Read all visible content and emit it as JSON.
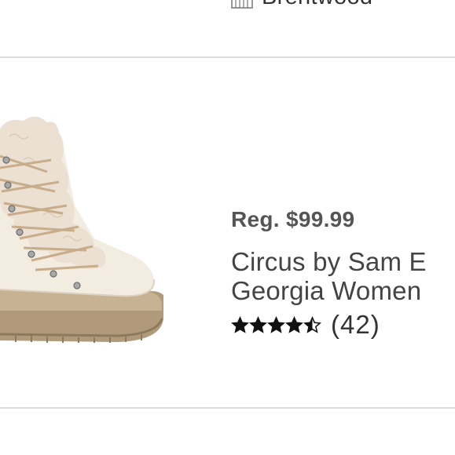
{
  "store": {
    "name": "Brentwood",
    "icon": "store-building-icon"
  },
  "product": {
    "image_alt": "cream shearling lace-up hiking boot",
    "price_label": "Reg. $99.99",
    "title_line1": "Circus by Sam E",
    "title_line2": "Georgia Women",
    "rating": {
      "value": 4.5,
      "max": 5,
      "review_count": "(42)"
    }
  },
  "colors": {
    "divider": "#dcdcdc",
    "price": "#555555",
    "title": "#444444",
    "star": "#111111"
  }
}
